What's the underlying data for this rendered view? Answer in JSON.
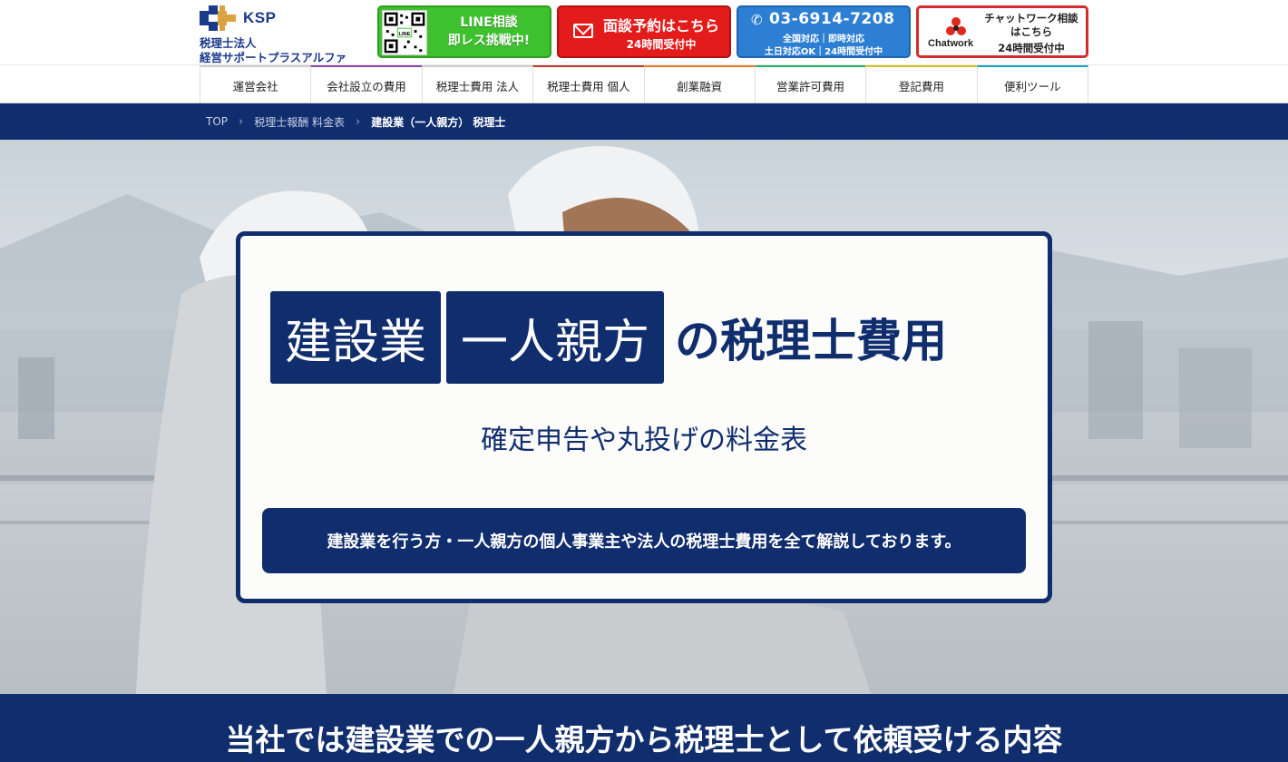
{
  "header": {
    "logo": {
      "short": "KSP",
      "line1": "税理士法人",
      "line2": "経営サポートプラスアルファ"
    },
    "line_cta": {
      "line1": "LINE相談",
      "line2": "即レス挑戦中!",
      "qr_label": "LINE",
      "color": "#3ec12e"
    },
    "mail_cta": {
      "title": "面談予約はこちら",
      "sub": "24時間受付中",
      "color": "#e41b1b"
    },
    "tel_cta": {
      "number": "03-6914-7208",
      "sub1": "全国対応｜即時対応",
      "sub2": "土日対応OK｜24時間受付中",
      "color": "#2d7fd3"
    },
    "chat_cta": {
      "brand": "Chatwork",
      "line1": "チャットワーク相談",
      "line2": "はこちら",
      "line3": "24時間受付中",
      "color": "#d22c2c"
    }
  },
  "nav": {
    "items": [
      {
        "label": "運営会社",
        "accent": "#cccccc"
      },
      {
        "label": "会社設立の費用",
        "accent": "#8e44ad"
      },
      {
        "label": "税理士費用 法人",
        "accent": "#cccccc"
      },
      {
        "label": "税理士費用 個人",
        "accent": "#c0392b"
      },
      {
        "label": "創業融資",
        "accent": "#e67e22"
      },
      {
        "label": "営業許可費用",
        "accent": "#27ae60"
      },
      {
        "label": "登記費用",
        "accent": "#d4c21a"
      },
      {
        "label": "便利ツール",
        "accent": "#16a2c2"
      }
    ]
  },
  "breadcrumb": {
    "items": [
      "TOP",
      "税理士報酬 料金表"
    ],
    "current": "建設業（一人親方） 税理士"
  },
  "hero": {
    "tag1": "建設業",
    "tag2": "一人親方",
    "title_rest": "の税理士費用",
    "subtitle": "確定申告や丸投げの料金表",
    "description": "建設業を行う方・一人親方の個人事業主や法人の税理士費用を全て解説しております。",
    "accent": "#102d6e"
  },
  "section": {
    "heading": "当社では建設業での一人親方から税理士として依頼受ける内容"
  }
}
